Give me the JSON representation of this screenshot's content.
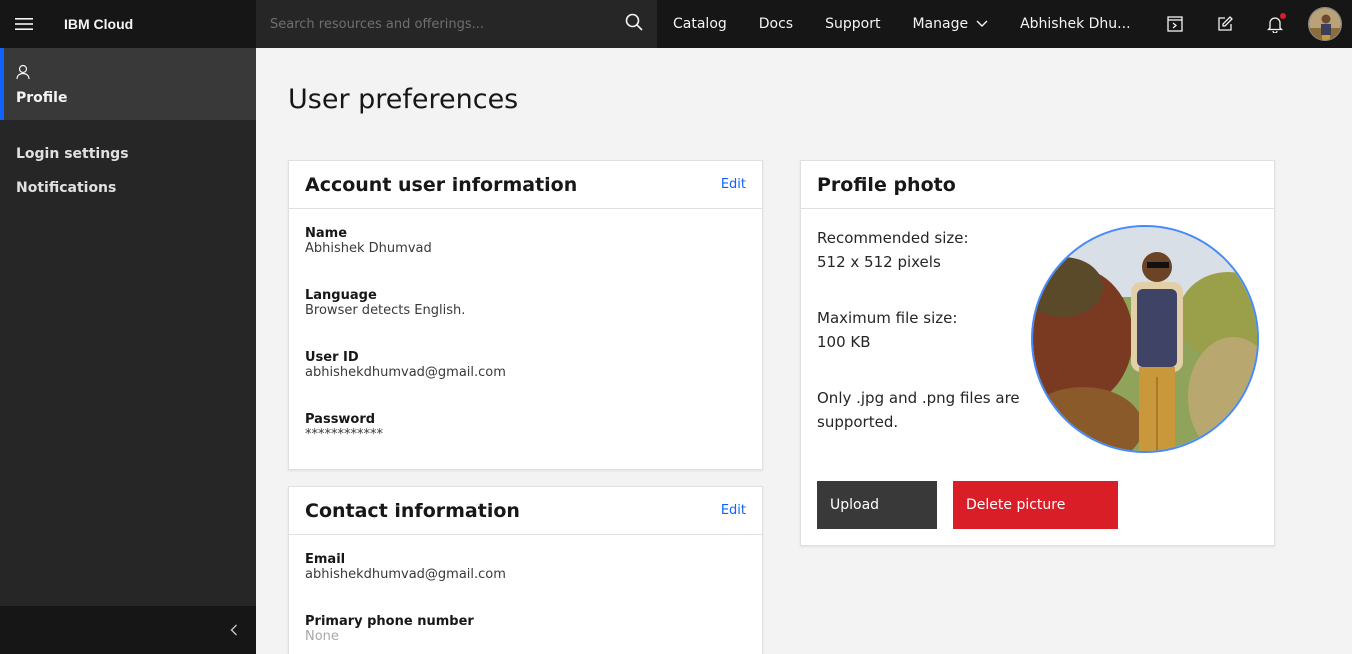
{
  "header": {
    "brand": "IBM Cloud",
    "search_placeholder": "Search resources and offerings...",
    "nav": {
      "catalog": "Catalog",
      "docs": "Docs",
      "support": "Support",
      "manage": "Manage",
      "user": "Abhishek Dhu..."
    },
    "icons": [
      "menu-icon",
      "search-icon",
      "chevron-down-icon",
      "cost-estimator-icon",
      "edit-icon",
      "notification-icon",
      "avatar"
    ]
  },
  "sidebar": {
    "active": "Profile",
    "items": [
      "Login settings",
      "Notifications"
    ]
  },
  "page": {
    "title": "User preferences"
  },
  "account": {
    "title": "Account user information",
    "edit": "Edit",
    "fields": [
      {
        "label": "Name",
        "value": "Abhishek Dhumvad"
      },
      {
        "label": "Language",
        "value": "Browser detects English."
      },
      {
        "label": "User ID",
        "value": "abhishekdhumvad@gmail.com"
      },
      {
        "label": "Password",
        "value": "************"
      }
    ]
  },
  "contact": {
    "title": "Contact information",
    "edit": "Edit",
    "fields": [
      {
        "label": "Email",
        "value": "abhishekdhumvad@gmail.com"
      },
      {
        "label": "Primary phone number",
        "value": "None"
      }
    ]
  },
  "photo": {
    "title": "Profile photo",
    "rec_line1": "Recommended size:",
    "rec_line2": "512 x 512 pixels",
    "max_line1": "Maximum file size:",
    "max_line2": "100 KB",
    "fmt_line1": "Only .jpg and .png files are",
    "fmt_line2": "supported.",
    "upload": "Upload",
    "delete": "Delete picture"
  },
  "colors": {
    "accent": "#0f62fe",
    "danger": "#da1e28",
    "topbar": "#161616",
    "sidebar": "#262626"
  }
}
